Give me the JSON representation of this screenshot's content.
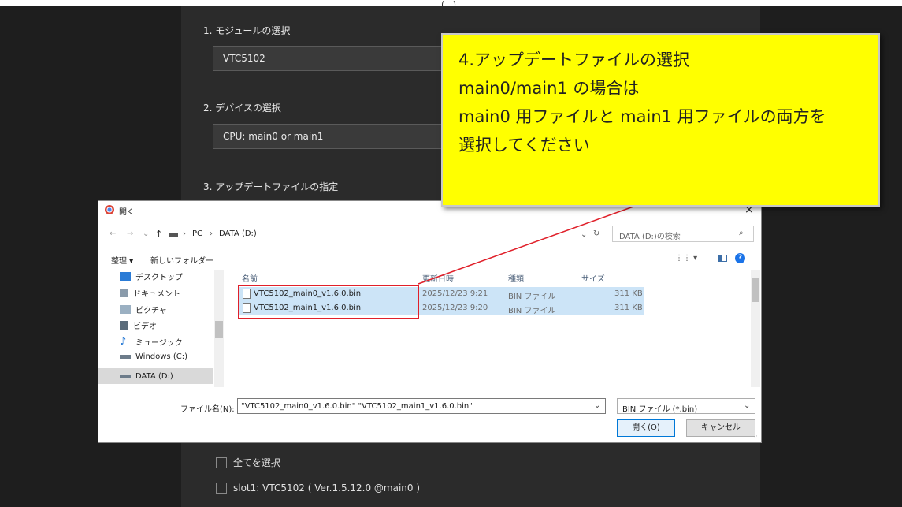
{
  "top_partial_text": "(       ,         )",
  "page": {
    "step1": {
      "label": "1. モジュールの選択",
      "value": "VTC5102"
    },
    "step2": {
      "label": "2. デバイスの選択",
      "value": "CPU: main0 or main1"
    },
    "step3": {
      "label": "3. アップデートファイルの指定"
    },
    "select_all_label": "全てを選択",
    "slot_label": "slot1: VTC5102 ( Ver.1.5.12.0 @main0 )"
  },
  "callout": {
    "lines": [
      "4.アップデートファイルの選択",
      "main0/main1 の場合は",
      "main0 用ファイルと main1 用ファイルの両方を",
      "選択してください"
    ]
  },
  "dialog": {
    "title": "開く",
    "close": "×",
    "breadcrumb": {
      "pc": "PC",
      "drive": "DATA (D:)",
      "sep": "›"
    },
    "search_placeholder": "DATA (D:)の検索",
    "toolbar": {
      "organize": "整理 ▾",
      "new_folder": "新しいフォルダー",
      "view": "⋮⋮ ▾"
    },
    "nav_items": [
      {
        "label": "デスクトップ",
        "icon": "desktop-icon",
        "color": "#2a7bd6"
      },
      {
        "label": "ドキュメント",
        "icon": "document-icon",
        "color": "#5a6b7a"
      },
      {
        "label": "ピクチャ",
        "icon": "picture-icon",
        "color": "#5a6b7a"
      },
      {
        "label": "ビデオ",
        "icon": "video-icon",
        "color": "#5a6b7a"
      },
      {
        "label": "ミュージック",
        "icon": "music-icon",
        "color": "#2a7bd6"
      },
      {
        "label": "Windows (C:)",
        "icon": "drive-icon",
        "color": "#5a6b7a"
      },
      {
        "label": "DATA (D:)",
        "icon": "drive-icon",
        "color": "#5a6b7a"
      }
    ],
    "columns": {
      "name": "名前",
      "date": "更新日時",
      "type": "種類",
      "size": "サイズ"
    },
    "files": [
      {
        "name": "VTC5102_main0_v1.6.0.bin",
        "date": "2025/12/23 9:21",
        "type": "BIN ファイル",
        "size": "311 KB"
      },
      {
        "name": "VTC5102_main1_v1.6.0.bin",
        "date": "2025/12/23 9:20",
        "type": "BIN ファイル",
        "size": "311 KB"
      }
    ],
    "filename_label": "ファイル名(N):",
    "filename_value": "\"VTC5102_main0_v1.6.0.bin\" \"VTC5102_main1_v1.6.0.bin\"",
    "filter_value": "BIN ファイル (*.bin)",
    "open_button": "開く(O)",
    "cancel_button": "キャンセル"
  },
  "colors": {
    "callout_fill": "#ffff00",
    "highlight_box": "#e0202a",
    "selection": "#cce4f7"
  }
}
